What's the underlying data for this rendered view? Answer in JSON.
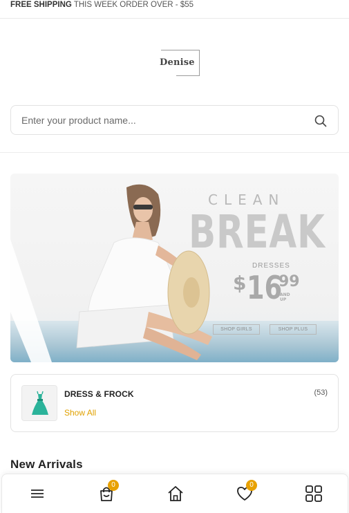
{
  "topbar": {
    "bold": "FREE SHIPPING",
    "text": "THIS WEEK ORDER OVER - $55"
  },
  "logo": {
    "text": "Denise"
  },
  "search": {
    "placeholder": "Enter your product name...",
    "icon": "search-icon"
  },
  "banner": {
    "headline_small": "CLEAN",
    "headline_big": "BREAK",
    "label": "DRESSES",
    "price_currency": "$",
    "price_main": "16",
    "price_cents": "99",
    "price_note": "AND UP",
    "button_girls": "SHOP GIRLS",
    "button_plus": "SHOP PLUS"
  },
  "category": {
    "name": "DRESS & FROCK",
    "count": "(53)",
    "link": "Show All"
  },
  "sections": {
    "new_arrivals": "New Arrivals"
  },
  "bottom_nav": {
    "menu_icon": "menu-icon",
    "cart_icon": "shopping-bag-icon",
    "cart_count": "0",
    "home_icon": "home-icon",
    "wishlist_icon": "heart-icon",
    "wishlist_count": "0",
    "grid_icon": "grid-icon"
  },
  "colors": {
    "accent": "#e8a100",
    "link": "#e0a100",
    "border": "#e2e2e2",
    "text": "#222222"
  }
}
